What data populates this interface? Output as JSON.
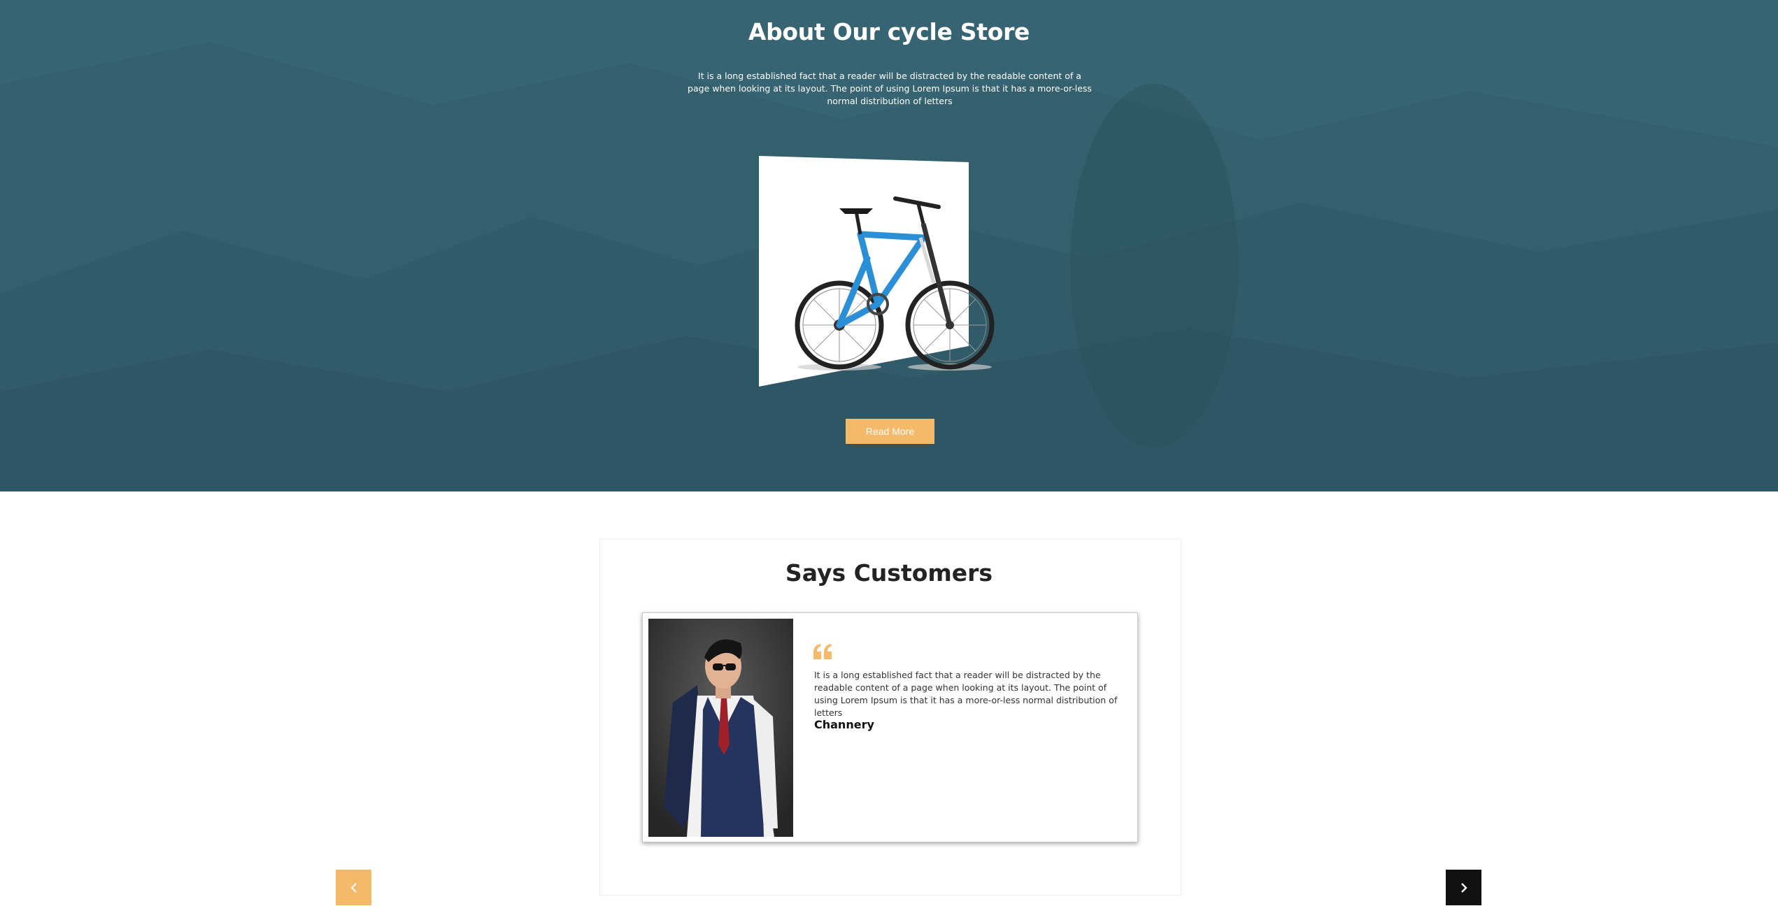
{
  "about": {
    "title": "About Our cycle Store",
    "description": "It is a long established fact that a reader will be distracted by the readable content of a page when looking at its layout. The point of using Lorem Ipsum is that it has a more-or-less normal distribution of letters",
    "button_label": "Read More",
    "background_color": "#34606e",
    "image_icon": "bicycle-image"
  },
  "testimonials": {
    "title": "Says Customers",
    "quote_icon": "quote-icon",
    "accent_color": "#f5b96a",
    "current": {
      "text": "It is a long established fact that a reader will be distracted by the readable content of a page when looking at its layout. The point of using Lorem Ipsum is that it has a more-or-less normal distribution of letters",
      "name": "Channery",
      "photo_icon": "customer-photo"
    },
    "prev_icon": "chevron-left-icon",
    "next_icon": "chevron-right-icon"
  }
}
